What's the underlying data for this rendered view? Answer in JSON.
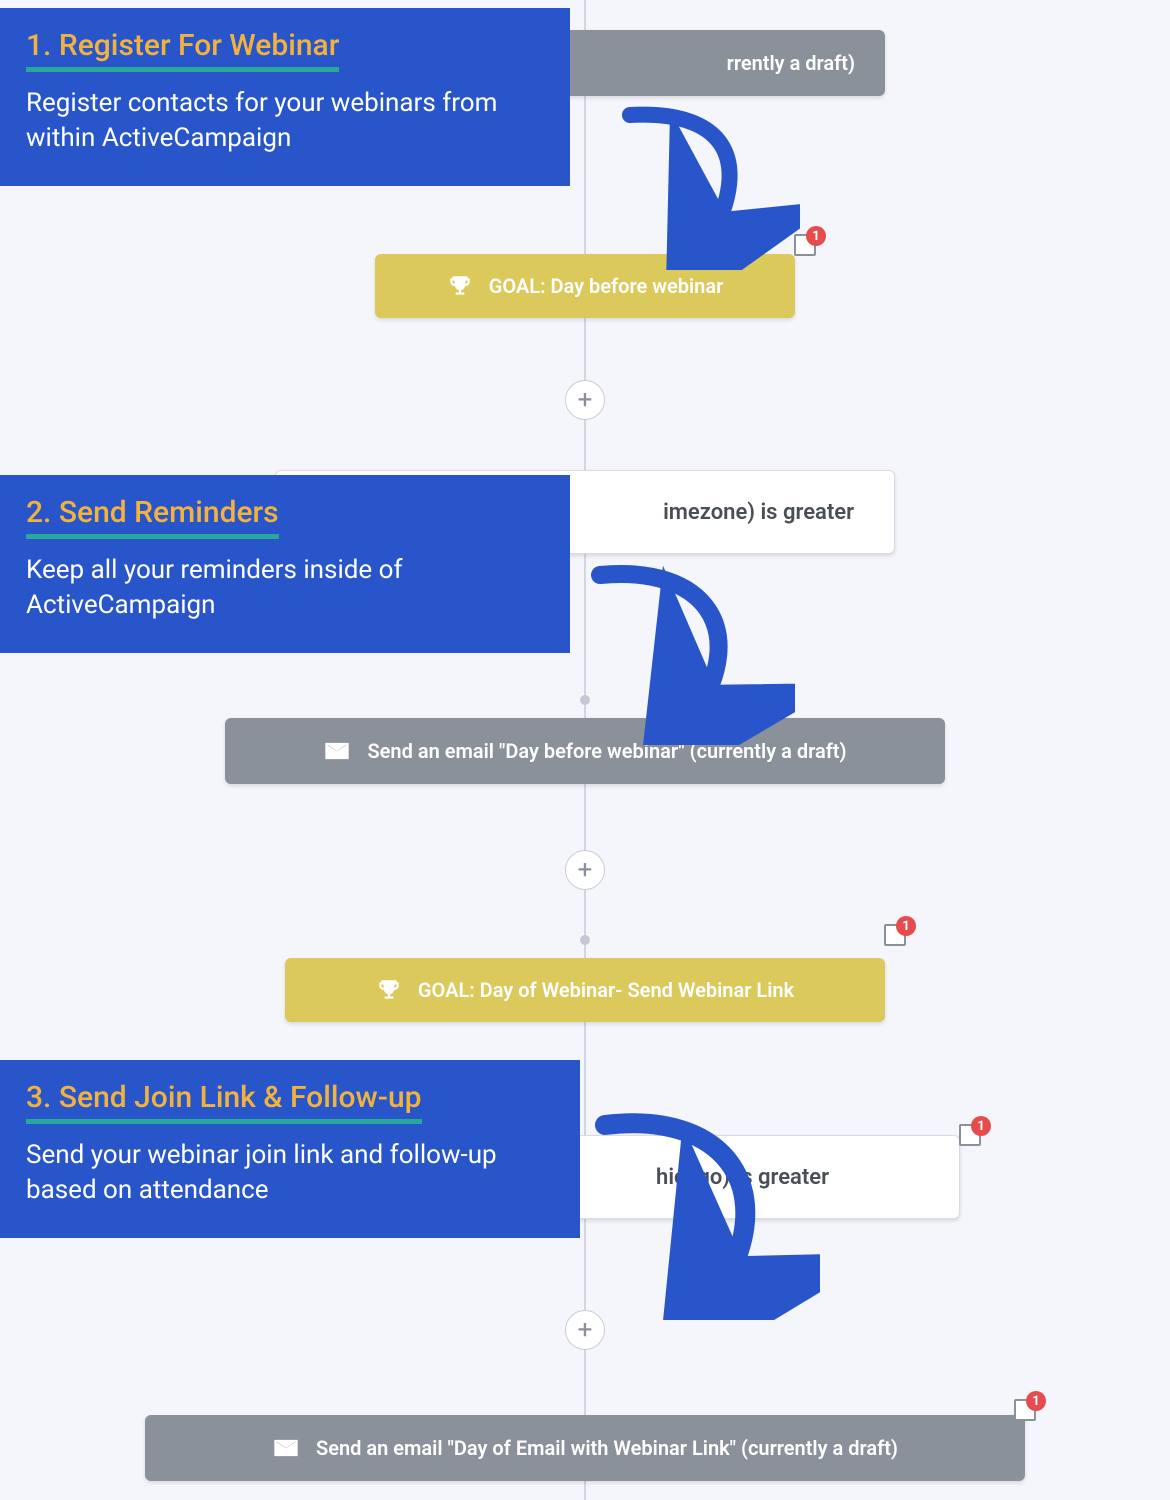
{
  "callouts": [
    {
      "title": "1. Register For Webinar",
      "body": "Register contacts for your webinars from within ActiveCampaign"
    },
    {
      "title": "2. Send Reminders",
      "body": "Keep all your reminders inside of ActiveCampaign"
    },
    {
      "title": "3. Send Join Link & Follow-up",
      "body": "Send your webinar join link and follow-up based on attendance"
    }
  ],
  "flow": {
    "email_top_fragment": "rrently a draft)",
    "goal1": "GOAL: Day before webinar",
    "cond1_fragment": "imezone) is greater",
    "email_mid": "Send an email \"Day before webinar\" (currently a draft)",
    "goal2": "GOAL: Day of Webinar- Send Webinar Link",
    "cond2_fragment": "hicago) is greater",
    "email_bot": "Send an email \"Day of Email with Webinar Link\" (currently a draft)",
    "plus": "+",
    "notes_count": "1"
  }
}
